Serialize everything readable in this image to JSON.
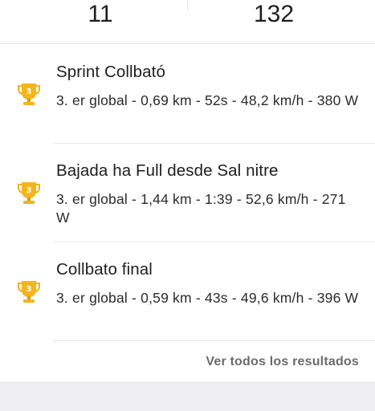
{
  "stats": {
    "left_value": "11",
    "right_value": "132"
  },
  "achievements": [
    {
      "rank_badge": "3",
      "title": "Sprint Collbató",
      "detail": "3. er global - 0,69 km - 52s - 48,2 km/h - 380 W"
    },
    {
      "rank_badge": "3",
      "title": "Bajada ha Full desde Sal nitre",
      "detail": "3. er global - 1,44 km - 1:39 - 52,6 km/h - 271 W"
    },
    {
      "rank_badge": "3",
      "title": "Collbato final",
      "detail": "3. er global - 0,59 km - 43s - 49,6 km/h - 396 W"
    }
  ],
  "see_all_label": "Ver todos los resultados",
  "colors": {
    "trophy_gold": "#f2b51c",
    "trophy_shadow": "#d99a10",
    "link_gray": "#6b6b6b"
  },
  "icons": {
    "trophy": "trophy-icon"
  }
}
